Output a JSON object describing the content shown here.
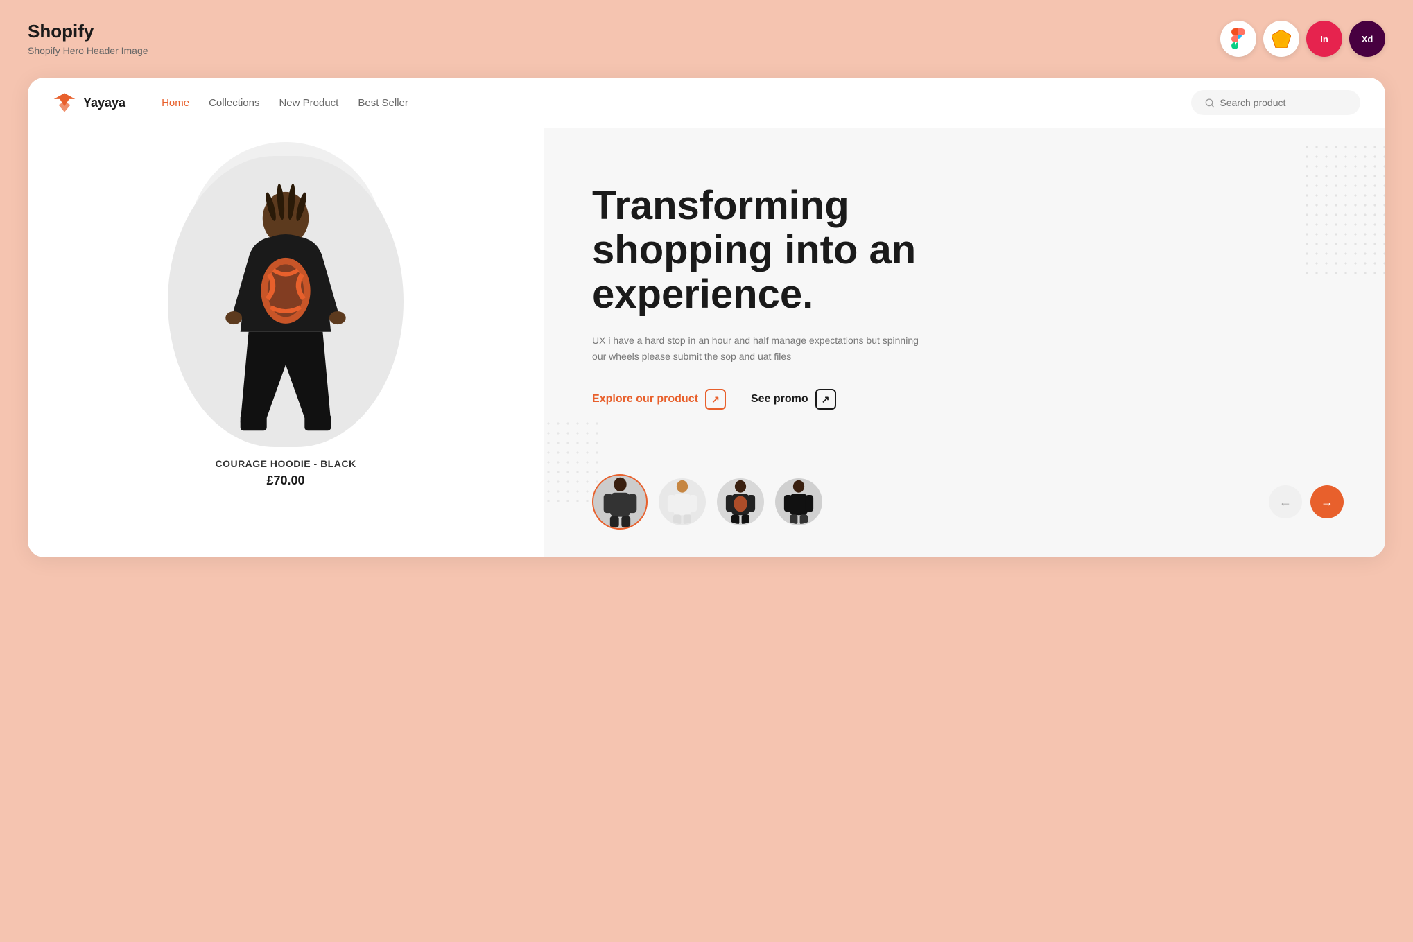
{
  "meta": {
    "app_name": "Shopify",
    "app_subtitle": "Shopify Hero Header Image"
  },
  "tools": [
    {
      "id": "figma",
      "label": "Figma"
    },
    {
      "id": "sketch",
      "label": "Sketch"
    },
    {
      "id": "invision",
      "label": "In"
    },
    {
      "id": "xd",
      "label": "Xd"
    }
  ],
  "navbar": {
    "logo_text": "Yayaya",
    "links": [
      {
        "label": "Home",
        "active": true
      },
      {
        "label": "Collections",
        "active": false
      },
      {
        "label": "New Product",
        "active": false
      },
      {
        "label": "Best Seller",
        "active": false
      }
    ],
    "search_placeholder": "Search product"
  },
  "hero": {
    "title": "Transforming shopping into an experience.",
    "subtitle": "UX i have a hard stop in an hour and half manage expectations but spinning our wheels please submit the sop and uat files",
    "cta_primary": "Explore our product",
    "cta_secondary": "See promo"
  },
  "featured_product": {
    "name": "COURAGE HOODIE - BLACK",
    "price": "£70.00"
  },
  "thumbnails": [
    {
      "id": 1,
      "emoji": "🧍",
      "active": true
    },
    {
      "id": 2,
      "emoji": "👕",
      "active": false
    },
    {
      "id": 3,
      "emoji": "👤",
      "active": false
    },
    {
      "id": 4,
      "emoji": "🧍",
      "active": false
    }
  ]
}
